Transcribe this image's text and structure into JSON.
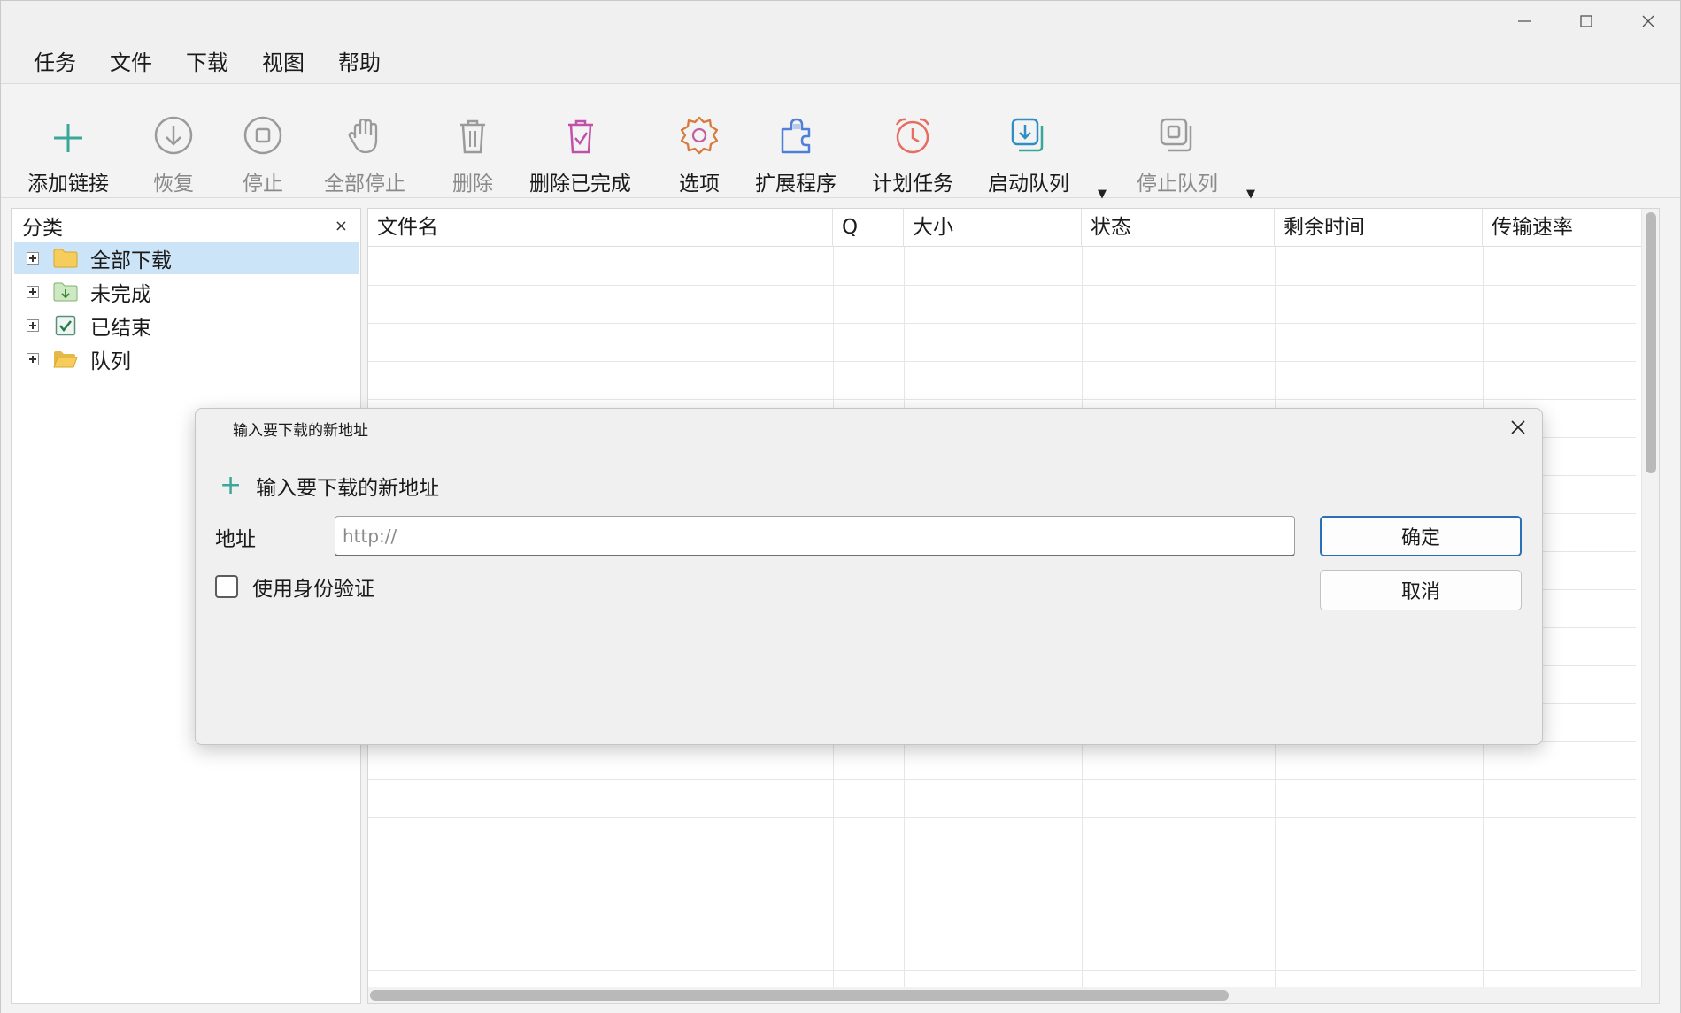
{
  "menu": [
    "任务",
    "文件",
    "下载",
    "视图",
    "帮助"
  ],
  "toolbar": {
    "add_link": "添加链接",
    "resume": "恢复",
    "stop": "停止",
    "stop_all": "全部停止",
    "delete": "删除",
    "delete_completed": "删除已完成",
    "options": "选项",
    "extensions": "扩展程序",
    "scheduler": "计划任务",
    "start_queue": "启动队列",
    "stop_queue": "停止队列",
    "dropdown_glyph": "▼"
  },
  "sidebar": {
    "title": "分类",
    "close_glyph": "×",
    "items": [
      {
        "label": "全部下载",
        "selected": true
      },
      {
        "label": "未完成",
        "selected": false
      },
      {
        "label": "已结束",
        "selected": false
      },
      {
        "label": "队列",
        "selected": false
      }
    ]
  },
  "table": {
    "columns": [
      "文件名",
      "Q",
      "大小",
      "状态",
      "剩余时间",
      "传输速率"
    ]
  },
  "dialog": {
    "title": "输入要下载的新地址",
    "heading": "输入要下载的新地址",
    "heading_glyph": "+",
    "address_label": "地址",
    "address_placeholder": "http://",
    "address_value": "",
    "ok_label": "确定",
    "cancel_label": "取消",
    "auth_label": "使用身份验证",
    "auth_checked": false
  },
  "colors": {
    "accent": "#2b6fb5",
    "add_green": "#3aa79a",
    "selection": "#cce4f7",
    "disabled_icon": "#9a9a9a"
  }
}
